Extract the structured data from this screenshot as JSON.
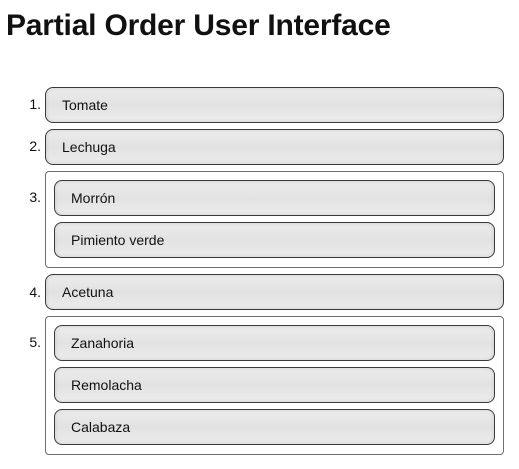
{
  "title": "Partial Order User Interface",
  "list": [
    {
      "number": "1.",
      "items": [
        "Tomate"
      ]
    },
    {
      "number": "2.",
      "items": [
        "Lechuga"
      ]
    },
    {
      "number": "3.",
      "items": [
        "Morrón",
        "Pimiento verde"
      ]
    },
    {
      "number": "4.",
      "items": [
        "Acetuna"
      ]
    },
    {
      "number": "5.",
      "items": [
        "Zanahoria",
        "Remolacha",
        "Calabaza"
      ]
    }
  ]
}
